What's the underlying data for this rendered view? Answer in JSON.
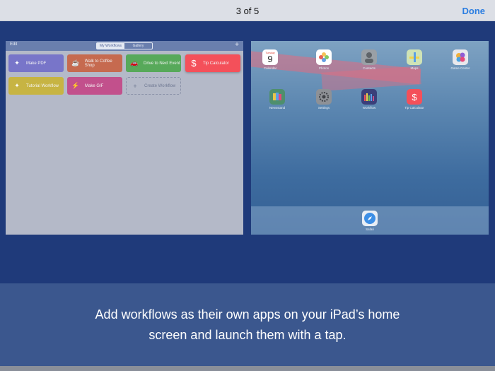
{
  "topbar": {
    "title": "3 of 5",
    "done_label": "Done"
  },
  "workflow_app": {
    "edit_label": "Edit",
    "segments": [
      "My Workflows",
      "Gallery"
    ],
    "plus_label": "+",
    "tiles": [
      {
        "label": "Make PDF",
        "icon": "wand-icon",
        "glyph": "✦"
      },
      {
        "label": "Walk to Coffee Shop",
        "icon": "coffee-cup-icon",
        "glyph": "☕"
      },
      {
        "label": "Drive to Next Event",
        "icon": "car-icon",
        "glyph": "🚗"
      },
      {
        "label": "Tip Calculator",
        "icon": "dollar-icon",
        "glyph": "$"
      },
      {
        "label": "Tutorial Workflow",
        "icon": "wand-icon",
        "glyph": "✦"
      },
      {
        "label": "Make GIF",
        "icon": "lightning-icon",
        "glyph": "⚡"
      },
      {
        "label": "Create Workflow",
        "icon": "plus-icon",
        "glyph": "+"
      }
    ]
  },
  "home_screen": {
    "apps": [
      {
        "label": "Calendar",
        "icon": "calendar-icon",
        "top": "Tuesday",
        "num": "9",
        "color": "#ffffff"
      },
      {
        "label": "Photos",
        "icon": "photos-icon",
        "color": "#ffffff"
      },
      {
        "label": "Contacts",
        "icon": "contacts-icon",
        "color": "#9aa0a6"
      },
      {
        "label": "Maps",
        "icon": "maps-icon",
        "color": "#cfe3b6"
      },
      {
        "label": "Game Center",
        "icon": "game-center-icon",
        "color": "#e8e8ec"
      },
      {
        "label": "Newsstand",
        "icon": "newsstand-icon",
        "color": "#4e8f6d"
      },
      {
        "label": "Settings",
        "icon": "settings-icon",
        "color": "#8e9196"
      },
      {
        "label": "Workflow",
        "icon": "workflow-icon",
        "color": "#3a3f7a"
      },
      {
        "label": "Tip Calculator",
        "icon": "dollar-icon",
        "color": "#f4505a"
      }
    ],
    "dock_app": {
      "label": "Safari",
      "icon": "safari-icon",
      "color": "#e9eef5"
    }
  },
  "caption": "Add workflows as their own apps on your iPad’s home screen and launch them with a tap."
}
